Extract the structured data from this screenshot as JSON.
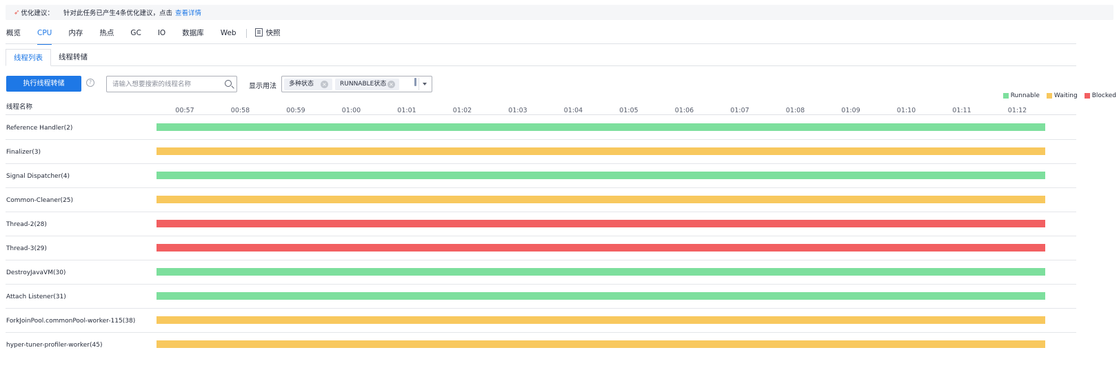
{
  "banner": {
    "icon": "rocket-icon",
    "label": "优化建议：",
    "message": "针对此任务已产生4条优化建议，点击",
    "link_text": "查看详情"
  },
  "main_tabs": [
    {
      "label": "概览",
      "active": false
    },
    {
      "label": "CPU",
      "active": true
    },
    {
      "label": "内存",
      "active": false
    },
    {
      "label": "热点",
      "active": false
    },
    {
      "label": "GC",
      "active": false
    },
    {
      "label": "IO",
      "active": false
    },
    {
      "label": "数据库",
      "active": false
    },
    {
      "label": "Web",
      "active": false
    }
  ],
  "snapshot_tab": {
    "label": "快照",
    "icon": "snapshot-icon"
  },
  "sub_tabs": [
    {
      "label": "线程列表",
      "active": true
    },
    {
      "label": "线程转储",
      "active": false
    }
  ],
  "toolbar": {
    "dump_button_label": "执行线程转储",
    "help_icon": "question-icon",
    "search_placeholder": "请输入想要搜索的线程名称",
    "search_value": "",
    "display_label": "显示用法",
    "filter_chips": [
      "多种状态",
      "RUNNABLE状态"
    ]
  },
  "legend": [
    {
      "label": "Runnable",
      "color": "#7ddf9d"
    },
    {
      "label": "Waiting",
      "color": "#f8c85e"
    },
    {
      "label": "Blocked",
      "color": "#f25f61"
    }
  ],
  "chart_data": {
    "type": "timeline",
    "column_header": "线程名称",
    "time_ticks": [
      "00:57",
      "00:58",
      "00:59",
      "01:00",
      "01:01",
      "01:02",
      "01:03",
      "01:04",
      "01:05",
      "01:06",
      "01:07",
      "01:08",
      "01:09",
      "01:10",
      "01:11",
      "01:12"
    ],
    "threads": [
      {
        "name": "Reference Handler(2)",
        "state": "Runnable"
      },
      {
        "name": "Finalizer(3)",
        "state": "Waiting"
      },
      {
        "name": "Signal Dispatcher(4)",
        "state": "Runnable"
      },
      {
        "name": "Common-Cleaner(25)",
        "state": "Waiting"
      },
      {
        "name": "Thread-2(28)",
        "state": "Blocked"
      },
      {
        "name": "Thread-3(29)",
        "state": "Blocked"
      },
      {
        "name": "DestroyJavaVM(30)",
        "state": "Runnable"
      },
      {
        "name": "Attach Listener(31)",
        "state": "Runnable"
      },
      {
        "name": "ForkJoinPool.commonPool-worker-115(38)",
        "state": "Waiting"
      },
      {
        "name": "hyper-tuner-profiler-worker(45)",
        "state": "Waiting"
      }
    ]
  }
}
